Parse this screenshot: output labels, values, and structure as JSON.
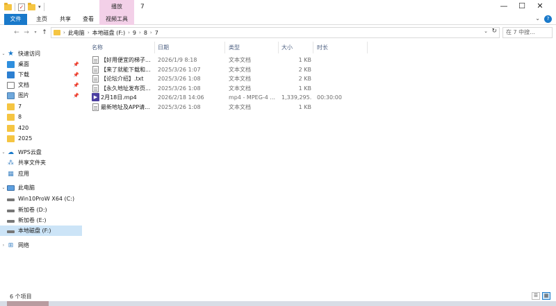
{
  "window": {
    "title": "7",
    "context_tab": "播放",
    "buttons": {
      "minimize": "—",
      "maximize": "☐",
      "close": "✕"
    }
  },
  "ribbon": {
    "tabs": [
      "文件",
      "主页",
      "共享",
      "查看",
      "视频工具"
    ],
    "expand": "⌄",
    "help": "?"
  },
  "address": {
    "crumbs": [
      "此电脑",
      "本地磁盘 (F:)",
      "9",
      "8",
      "7"
    ],
    "search_placeholder": "在 7 中搜..."
  },
  "nav": {
    "quick_access": "快速访问",
    "pinned": [
      {
        "label": "桌面",
        "icon": "desktop-icon"
      },
      {
        "label": "下载",
        "icon": "download-icon"
      },
      {
        "label": "文档",
        "icon": "documents-icon"
      },
      {
        "label": "图片",
        "icon": "pictures-icon"
      }
    ],
    "folders": [
      "7",
      "8",
      "420",
      "2025"
    ],
    "wps": "WPS云盘",
    "wps_items": [
      "共享文件夹",
      "应用"
    ],
    "this_pc": "此电脑",
    "drives": [
      "Win10ProW X64 (C:)",
      "新加卷 (D:)",
      "新加卷 (E:)",
      "本地磁盘 (F:)"
    ],
    "network": "网络"
  },
  "list": {
    "headers": {
      "name": "名称",
      "date": "日期",
      "type": "类型",
      "size": "大小",
      "duration": "时长"
    },
    "rows": [
      {
        "name": "【好用便宜的梯子...",
        "date": "2026/1/9 8:18",
        "type": "文本文档",
        "size": "1 KB",
        "duration": ""
      },
      {
        "name": "【来了就能下载和...",
        "date": "2025/3/26 1:07",
        "type": "文本文档",
        "size": "2 KB",
        "duration": ""
      },
      {
        "name": "【论坛介绍】.txt",
        "date": "2025/3/26 1:08",
        "type": "文本文档",
        "size": "2 KB",
        "duration": ""
      },
      {
        "name": "【永久地址发布页...",
        "date": "2025/3/26 1:08",
        "type": "文本文档",
        "size": "1 KB",
        "duration": ""
      },
      {
        "name": "2月18日.mp4",
        "date": "2026/2/18 14:06",
        "type": "mp4 - MPEG-4 ...",
        "size": "1,339,295...",
        "duration": "00:30:00"
      },
      {
        "name": "最新地址及APP请...",
        "date": "2025/3/26 1:08",
        "type": "文本文档",
        "size": "1 KB",
        "duration": ""
      }
    ]
  },
  "status": {
    "count": "6 个项目"
  }
}
